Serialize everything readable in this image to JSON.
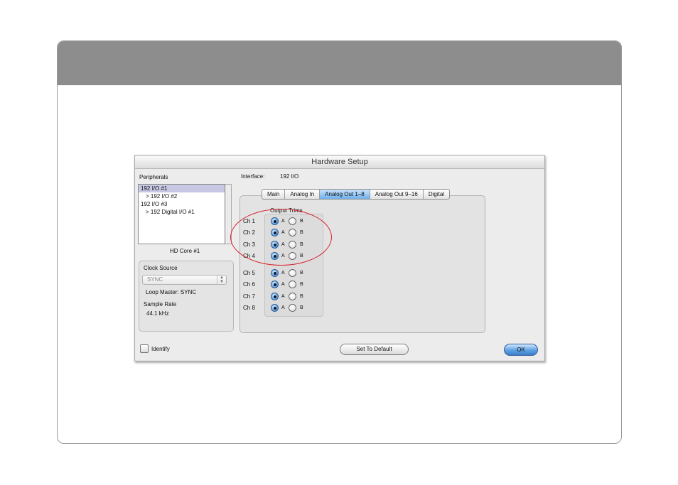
{
  "dialog": {
    "title": "Hardware Setup",
    "peripherals_label": "Peripherals",
    "peripherals": [
      {
        "label": "192 I/O #1",
        "selected": true
      },
      {
        "label": "> 192 I/O #2",
        "selected": false
      },
      {
        "label": "192 I/O #3",
        "selected": false
      },
      {
        "label": "> 192 Digital I/O #1",
        "selected": false
      }
    ],
    "core_label": "HD Core #1",
    "clock_source_label": "Clock Source",
    "clock_source_value": "SYNC",
    "loop_master": "Loop Master: SYNC",
    "sample_rate_label": "Sample Rate",
    "sample_rate_value": "44.1 kHz",
    "interface_label": "Interface:",
    "interface_value": "192 I/O",
    "tabs": [
      {
        "label": "Main",
        "active": false
      },
      {
        "label": "Analog In",
        "active": false
      },
      {
        "label": "Analog Out 1–8",
        "active": true
      },
      {
        "label": "Analog Out 9–16",
        "active": false
      },
      {
        "label": "Digital",
        "active": false
      }
    ],
    "output_trims_label": "Output Trims",
    "option_a": "A",
    "option_b": "B",
    "channels": [
      {
        "label": "Ch 1",
        "selected": "A"
      },
      {
        "label": "Ch 2",
        "selected": "A"
      },
      {
        "label": "Ch 3",
        "selected": "A"
      },
      {
        "label": "Ch 4",
        "selected": "A"
      },
      {
        "label": "Ch 5",
        "selected": "A"
      },
      {
        "label": "Ch 6",
        "selected": "A"
      },
      {
        "label": "Ch 7",
        "selected": "A"
      },
      {
        "label": "Ch 8",
        "selected": "A"
      }
    ],
    "identify_label": "Identify",
    "identify_checked": false,
    "set_default_label": "Set To Default",
    "ok_label": "OK"
  },
  "colors": {
    "header_band": "#8e8d8d",
    "highlight_circle": "#d8212a",
    "selected_tab": "#6fb0ec",
    "selected_list_item": "#c8c7e4"
  }
}
